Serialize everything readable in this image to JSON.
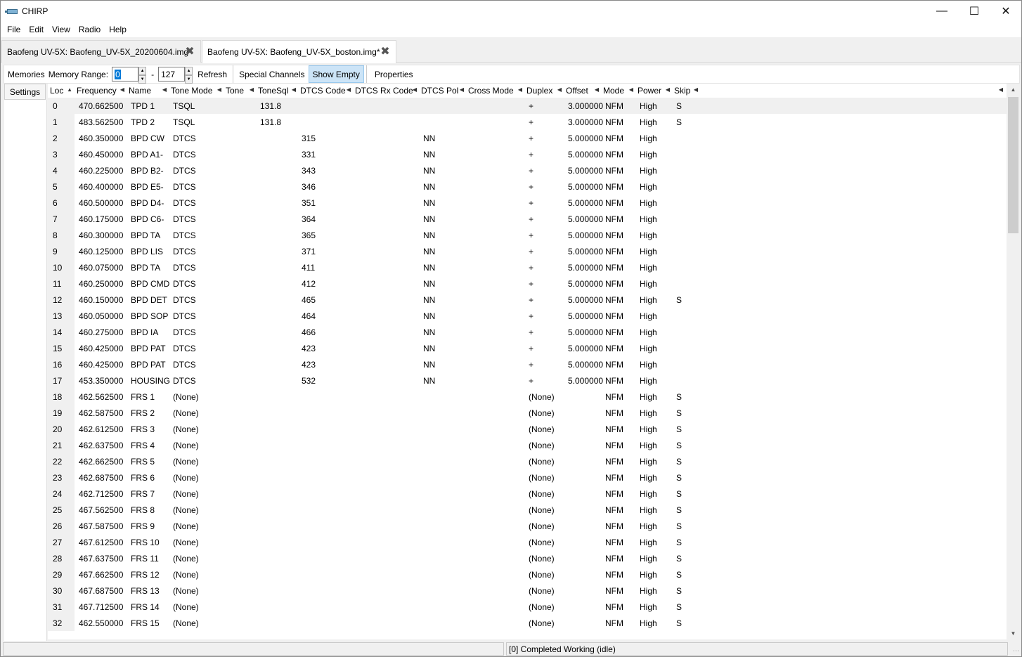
{
  "window": {
    "title": "CHIRP"
  },
  "menu": [
    "File",
    "Edit",
    "View",
    "Radio",
    "Help"
  ],
  "tabs": [
    {
      "label": "Baofeng UV-5X: Baofeng_UV-5X_20200604.img*"
    },
    {
      "label": "Baofeng UV-5X: Baofeng_UV-5X_boston.img*"
    }
  ],
  "toolbar": {
    "memories_label": "Memories",
    "range_label": "Memory Range:",
    "range_start": "0",
    "range_sep": "-",
    "range_end": "127",
    "refresh": "Refresh",
    "special": "Special Channels",
    "show_empty": "Show Empty",
    "properties": "Properties"
  },
  "settings_label": "Settings",
  "columns": [
    "Loc",
    "Frequency",
    "Name",
    "Tone Mode",
    "Tone",
    "ToneSql",
    "DTCS Code",
    "DTCS Rx Code",
    "DTCS Pol",
    "Cross Mode",
    "Duplex",
    "Offset",
    "Mode",
    "Power",
    "Skip"
  ],
  "rows": [
    [
      "0",
      "470.662500",
      "TPD 1",
      "TSQL",
      "",
      "131.8",
      "",
      "",
      "",
      "",
      "+",
      "3.000000",
      "NFM",
      "High",
      "S"
    ],
    [
      "1",
      "483.562500",
      "TPD 2",
      "TSQL",
      "",
      "131.8",
      "",
      "",
      "",
      "",
      "+",
      "3.000000",
      "NFM",
      "High",
      "S"
    ],
    [
      "2",
      "460.350000",
      "BPD CW",
      "DTCS",
      "",
      "",
      "315",
      "",
      "NN",
      "",
      "+",
      "5.000000",
      "NFM",
      "High",
      ""
    ],
    [
      "3",
      "460.450000",
      "BPD A1-",
      "DTCS",
      "",
      "",
      "331",
      "",
      "NN",
      "",
      "+",
      "5.000000",
      "NFM",
      "High",
      ""
    ],
    [
      "4",
      "460.225000",
      "BPD B2-",
      "DTCS",
      "",
      "",
      "343",
      "",
      "NN",
      "",
      "+",
      "5.000000",
      "NFM",
      "High",
      ""
    ],
    [
      "5",
      "460.400000",
      "BPD E5-",
      "DTCS",
      "",
      "",
      "346",
      "",
      "NN",
      "",
      "+",
      "5.000000",
      "NFM",
      "High",
      ""
    ],
    [
      "6",
      "460.500000",
      "BPD D4-",
      "DTCS",
      "",
      "",
      "351",
      "",
      "NN",
      "",
      "+",
      "5.000000",
      "NFM",
      "High",
      ""
    ],
    [
      "7",
      "460.175000",
      "BPD C6-",
      "DTCS",
      "",
      "",
      "364",
      "",
      "NN",
      "",
      "+",
      "5.000000",
      "NFM",
      "High",
      ""
    ],
    [
      "8",
      "460.300000",
      "BPD TA",
      "DTCS",
      "",
      "",
      "365",
      "",
      "NN",
      "",
      "+",
      "5.000000",
      "NFM",
      "High",
      ""
    ],
    [
      "9",
      "460.125000",
      "BPD LIS",
      "DTCS",
      "",
      "",
      "371",
      "",
      "NN",
      "",
      "+",
      "5.000000",
      "NFM",
      "High",
      ""
    ],
    [
      "10",
      "460.075000",
      "BPD TA",
      "DTCS",
      "",
      "",
      "411",
      "",
      "NN",
      "",
      "+",
      "5.000000",
      "NFM",
      "High",
      ""
    ],
    [
      "11",
      "460.250000",
      "BPD CMD",
      "DTCS",
      "",
      "",
      "412",
      "",
      "NN",
      "",
      "+",
      "5.000000",
      "NFM",
      "High",
      ""
    ],
    [
      "12",
      "460.150000",
      "BPD DET",
      "DTCS",
      "",
      "",
      "465",
      "",
      "NN",
      "",
      "+",
      "5.000000",
      "NFM",
      "High",
      "S"
    ],
    [
      "13",
      "460.050000",
      "BPD SOP",
      "DTCS",
      "",
      "",
      "464",
      "",
      "NN",
      "",
      "+",
      "5.000000",
      "NFM",
      "High",
      ""
    ],
    [
      "14",
      "460.275000",
      "BPD IA",
      "DTCS",
      "",
      "",
      "466",
      "",
      "NN",
      "",
      "+",
      "5.000000",
      "NFM",
      "High",
      ""
    ],
    [
      "15",
      "460.425000",
      "BPD PAT",
      "DTCS",
      "",
      "",
      "423",
      "",
      "NN",
      "",
      "+",
      "5.000000",
      "NFM",
      "High",
      ""
    ],
    [
      "16",
      "460.425000",
      "BPD PAT",
      "DTCS",
      "",
      "",
      "423",
      "",
      "NN",
      "",
      "+",
      "5.000000",
      "NFM",
      "High",
      ""
    ],
    [
      "17",
      "453.350000",
      "HOUSING",
      "DTCS",
      "",
      "",
      "532",
      "",
      "NN",
      "",
      "+",
      "5.000000",
      "NFM",
      "High",
      ""
    ],
    [
      "18",
      "462.562500",
      "FRS 1",
      "(None)",
      "",
      "",
      "",
      "",
      "",
      "",
      "(None)",
      "",
      "NFM",
      "High",
      "S"
    ],
    [
      "19",
      "462.587500",
      "FRS 2",
      "(None)",
      "",
      "",
      "",
      "",
      "",
      "",
      "(None)",
      "",
      "NFM",
      "High",
      "S"
    ],
    [
      "20",
      "462.612500",
      "FRS 3",
      "(None)",
      "",
      "",
      "",
      "",
      "",
      "",
      "(None)",
      "",
      "NFM",
      "High",
      "S"
    ],
    [
      "21",
      "462.637500",
      "FRS 4",
      "(None)",
      "",
      "",
      "",
      "",
      "",
      "",
      "(None)",
      "",
      "NFM",
      "High",
      "S"
    ],
    [
      "22",
      "462.662500",
      "FRS 5",
      "(None)",
      "",
      "",
      "",
      "",
      "",
      "",
      "(None)",
      "",
      "NFM",
      "High",
      "S"
    ],
    [
      "23",
      "462.687500",
      "FRS 6",
      "(None)",
      "",
      "",
      "",
      "",
      "",
      "",
      "(None)",
      "",
      "NFM",
      "High",
      "S"
    ],
    [
      "24",
      "462.712500",
      "FRS 7",
      "(None)",
      "",
      "",
      "",
      "",
      "",
      "",
      "(None)",
      "",
      "NFM",
      "High",
      "S"
    ],
    [
      "25",
      "467.562500",
      "FRS 8",
      "(None)",
      "",
      "",
      "",
      "",
      "",
      "",
      "(None)",
      "",
      "NFM",
      "High",
      "S"
    ],
    [
      "26",
      "467.587500",
      "FRS 9",
      "(None)",
      "",
      "",
      "",
      "",
      "",
      "",
      "(None)",
      "",
      "NFM",
      "High",
      "S"
    ],
    [
      "27",
      "467.612500",
      "FRS 10",
      "(None)",
      "",
      "",
      "",
      "",
      "",
      "",
      "(None)",
      "",
      "NFM",
      "High",
      "S"
    ],
    [
      "28",
      "467.637500",
      "FRS 11",
      "(None)",
      "",
      "",
      "",
      "",
      "",
      "",
      "(None)",
      "",
      "NFM",
      "High",
      "S"
    ],
    [
      "29",
      "467.662500",
      "FRS 12",
      "(None)",
      "",
      "",
      "",
      "",
      "",
      "",
      "(None)",
      "",
      "NFM",
      "High",
      "S"
    ],
    [
      "30",
      "467.687500",
      "FRS 13",
      "(None)",
      "",
      "",
      "",
      "",
      "",
      "",
      "(None)",
      "",
      "NFM",
      "High",
      "S"
    ],
    [
      "31",
      "467.712500",
      "FRS 14",
      "(None)",
      "",
      "",
      "",
      "",
      "",
      "",
      "(None)",
      "",
      "NFM",
      "High",
      "S"
    ],
    [
      "32",
      "462.550000",
      "FRS 15",
      "(None)",
      "",
      "",
      "",
      "",
      "",
      "",
      "(None)",
      "",
      "NFM",
      "High",
      "S"
    ]
  ],
  "status": {
    "left": "",
    "right": "[0] Completed Working (idle)"
  },
  "icons": {
    "close_tab": "close-x-icon",
    "sort": "sort-arrow-icon"
  },
  "colors": {
    "selection": "#0078d7",
    "pressed_button": "#cce4f7"
  }
}
